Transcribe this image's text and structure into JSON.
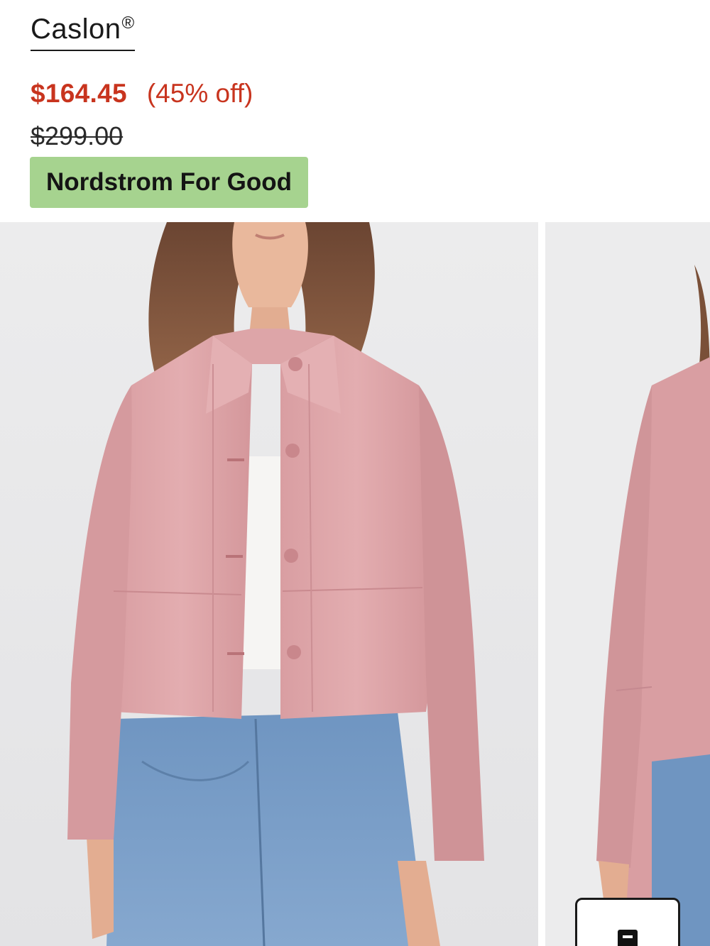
{
  "product": {
    "brand": "Caslon",
    "brand_mark": "®",
    "sale_price": "$164.45",
    "discount": "(45% off)",
    "original_price": "$299.00",
    "badge": "Nordstrom For Good"
  },
  "gallery": {
    "images": [
      {
        "name": "product-image-front",
        "subject": "pink suede cropped jacket worn over white top and blue jeans"
      },
      {
        "name": "product-image-side",
        "subject": "pink suede cropped jacket side view"
      }
    ]
  },
  "float_button": {
    "icon": "bag-icon"
  },
  "colors": {
    "sale_red": "#c8341e",
    "badge_green": "#a6d38f",
    "image_bg": "#ebebec",
    "jacket_pink": "#dba3a6"
  }
}
